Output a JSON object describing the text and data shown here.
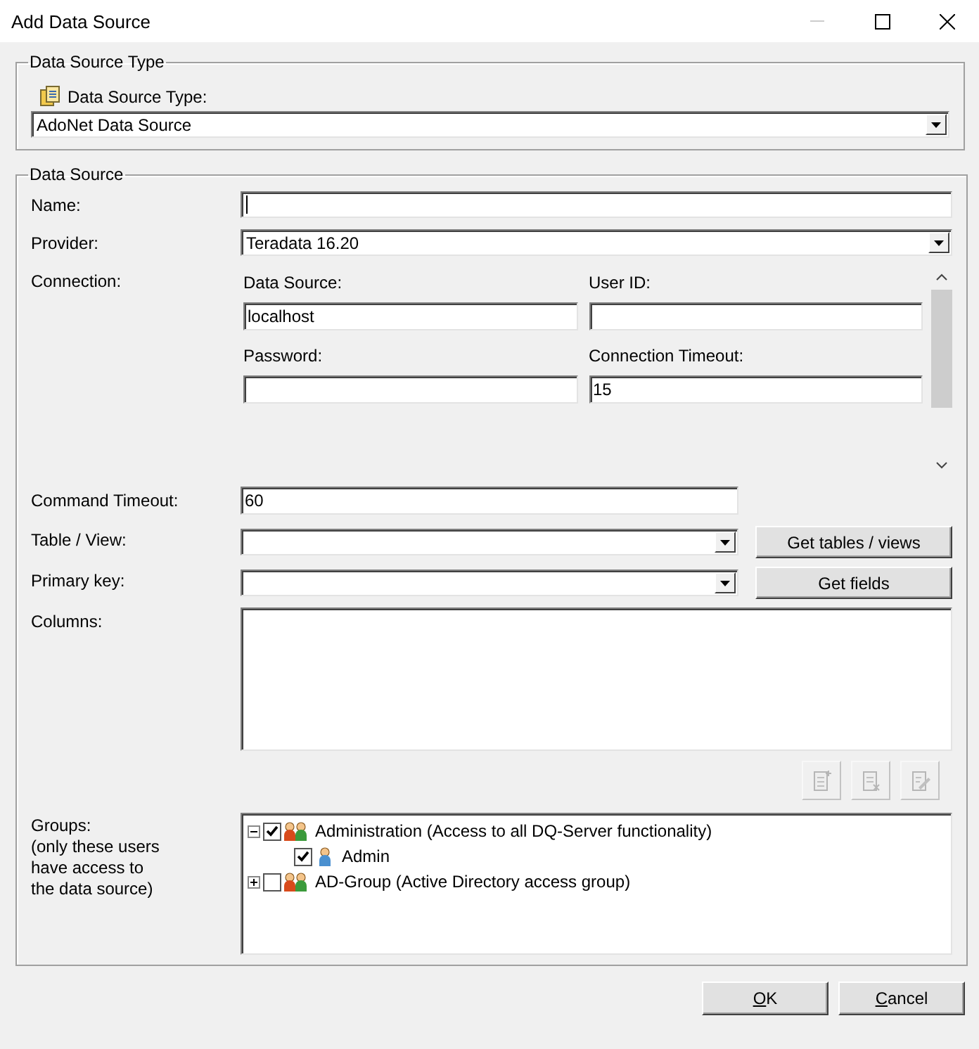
{
  "window": {
    "title": "Add Data Source"
  },
  "type_group": {
    "legend": "Data Source Type",
    "label": "Data Source Type:",
    "value": "AdoNet Data Source"
  },
  "source_group": {
    "legend": "Data Source",
    "name": {
      "label": "Name:",
      "focused": true
    },
    "provider": {
      "label": "Provider:",
      "value": "Teradata 16.20"
    },
    "connection": {
      "label": "Connection:",
      "fields": [
        {
          "label": "Data Source:",
          "value": "localhost"
        },
        {
          "label": "User ID:"
        },
        {
          "label": "Password:"
        },
        {
          "label": "Connection Timeout:",
          "value": "15"
        }
      ]
    },
    "command_timeout": {
      "label": "Command Timeout:",
      "value": "60"
    },
    "table_view": {
      "label": "Table / View:",
      "button": "Get tables / views"
    },
    "primary_key": {
      "label": "Primary key:",
      "button": "Get fields"
    },
    "columns": {
      "label": "Columns:",
      "tools": [
        {
          "kind": "add",
          "disabled": true
        },
        {
          "kind": "remove",
          "disabled": true
        },
        {
          "kind": "edit",
          "disabled": true
        }
      ]
    },
    "groups": {
      "label": "Groups:\n(only these users\nhave access to\nthe data source)",
      "tree": [
        {
          "label": "Administration (Access to all DQ-Server functionality)",
          "kind": "group",
          "checked": true,
          "expanded": true,
          "children": [
            {
              "label": "Admin",
              "kind": "user",
              "checked": true
            }
          ]
        },
        {
          "label": "AD-Group (Active Directory access group)",
          "kind": "group",
          "checked": false,
          "expanded": false
        }
      ]
    }
  },
  "buttons": [
    "OK",
    "Cancel"
  ]
}
